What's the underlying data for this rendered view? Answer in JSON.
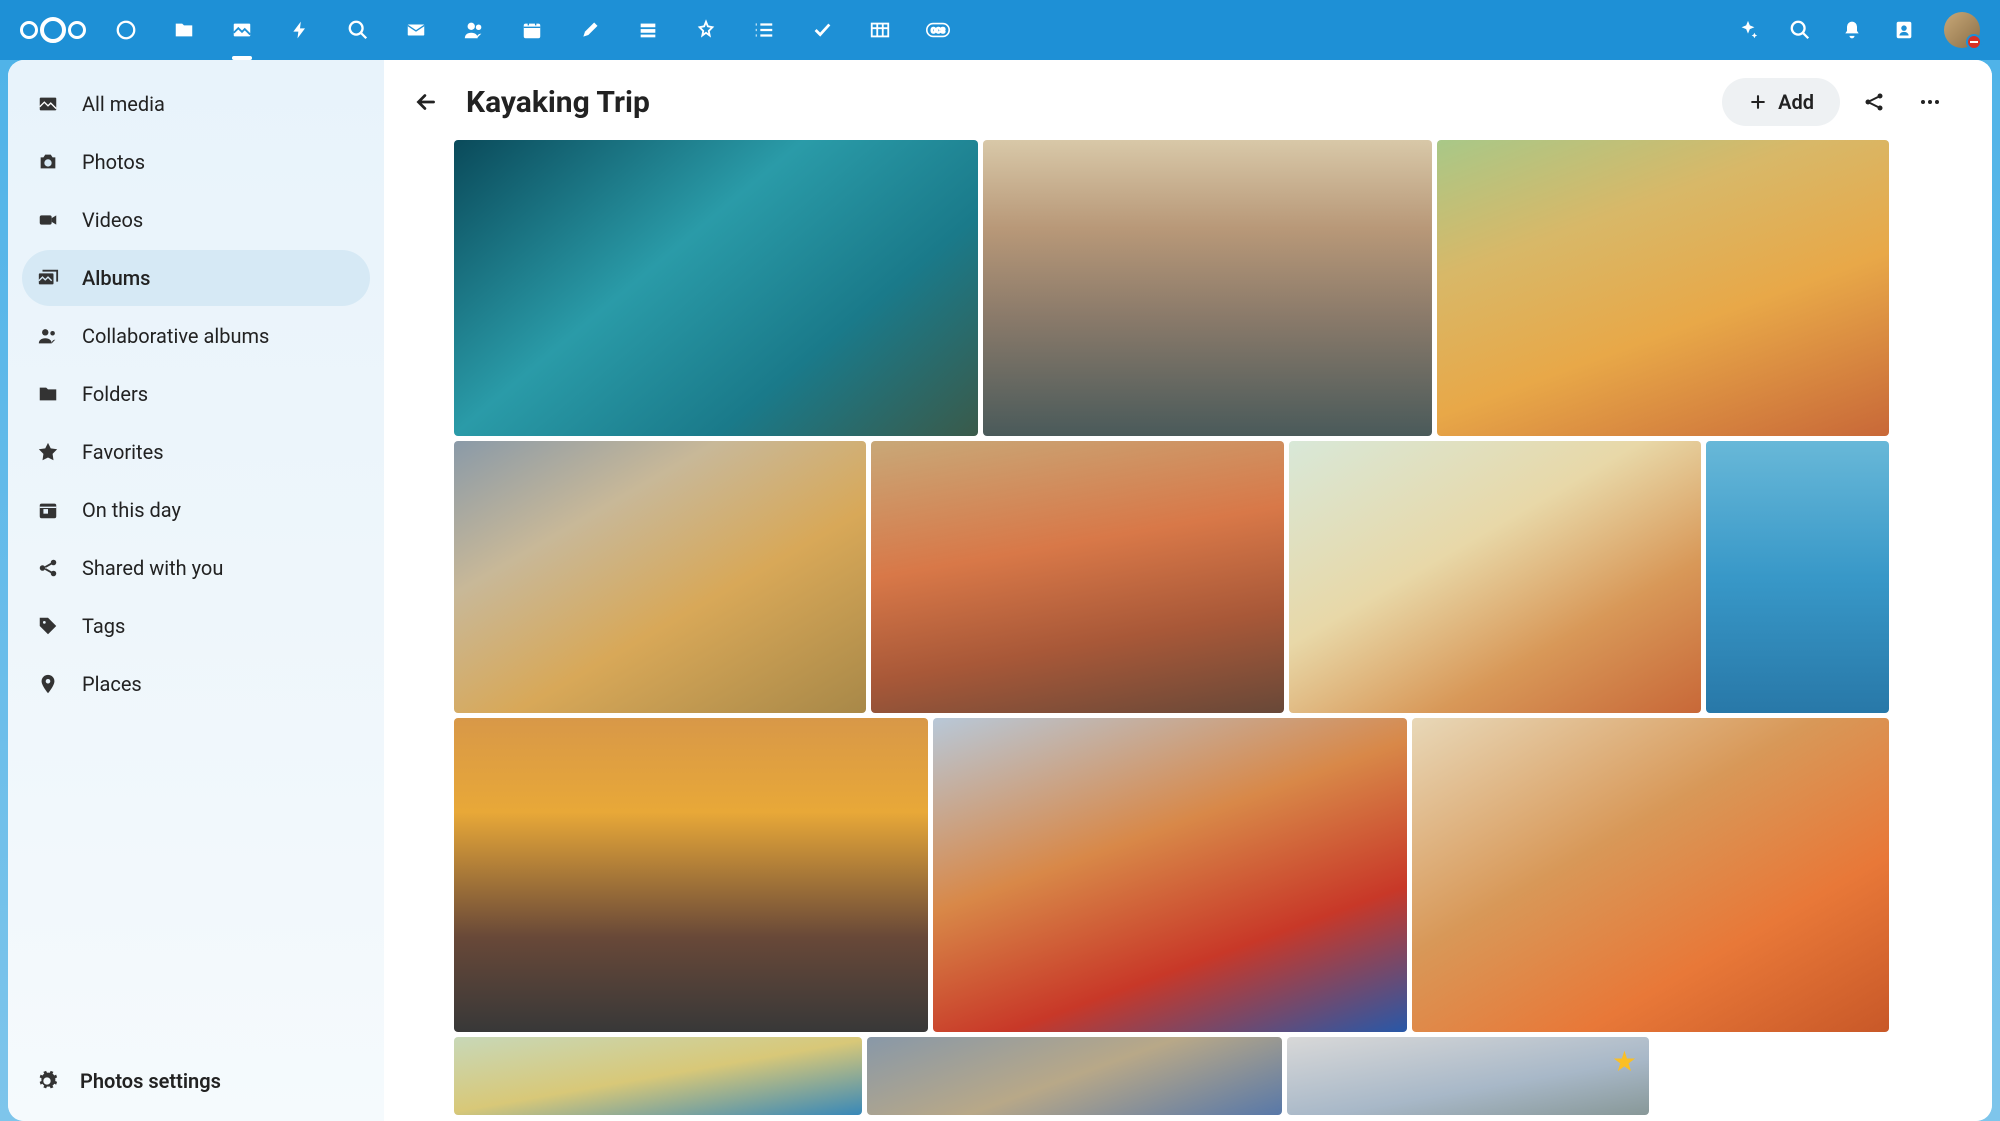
{
  "app": {
    "name": "Nextcloud"
  },
  "topbar": {
    "apps": [
      {
        "name": "dashboard-icon"
      },
      {
        "name": "files-icon"
      },
      {
        "name": "photos-icon",
        "active": true
      },
      {
        "name": "activity-icon"
      },
      {
        "name": "search-app-icon"
      },
      {
        "name": "mail-icon"
      },
      {
        "name": "contacts-app-icon"
      },
      {
        "name": "calendar-icon"
      },
      {
        "name": "notes-icon"
      },
      {
        "name": "deck-icon"
      },
      {
        "name": "recognize-icon"
      },
      {
        "name": "list-icon"
      },
      {
        "name": "tasks-icon"
      },
      {
        "name": "tables-icon"
      },
      {
        "name": "ocs-icon"
      }
    ],
    "right": [
      {
        "name": "assistant-icon"
      },
      {
        "name": "search-icon"
      },
      {
        "name": "notifications-icon"
      },
      {
        "name": "contacts-icon"
      }
    ]
  },
  "sidebar": {
    "items": [
      {
        "label": "All media",
        "icon": "image-icon"
      },
      {
        "label": "Photos",
        "icon": "camera-icon"
      },
      {
        "label": "Videos",
        "icon": "video-icon"
      },
      {
        "label": "Albums",
        "icon": "album-icon",
        "active": true
      },
      {
        "label": "Collaborative albums",
        "icon": "group-icon"
      },
      {
        "label": "Folders",
        "icon": "folder-icon"
      },
      {
        "label": "Favorites",
        "icon": "star-icon"
      },
      {
        "label": "On this day",
        "icon": "today-icon"
      },
      {
        "label": "Shared with you",
        "icon": "share-icon"
      },
      {
        "label": "Tags",
        "icon": "tag-icon"
      },
      {
        "label": "Places",
        "icon": "place-icon"
      }
    ],
    "footer": {
      "label": "Photos settings",
      "icon": "gear-icon"
    }
  },
  "header": {
    "title": "Kayaking Trip",
    "add_label": "Add"
  },
  "gallery": {
    "rows": [
      [
        {
          "id": "r1a"
        },
        {
          "id": "r1b"
        },
        {
          "id": "r1c"
        }
      ],
      [
        {
          "id": "r2a"
        },
        {
          "id": "r2b"
        },
        {
          "id": "r2c"
        },
        {
          "id": "r2d"
        }
      ],
      [
        {
          "id": "r3a"
        },
        {
          "id": "r3b"
        },
        {
          "id": "r3c"
        }
      ],
      [
        {
          "id": "r4a"
        },
        {
          "id": "r4b"
        },
        {
          "id": "r4c",
          "favorite": true
        }
      ]
    ]
  }
}
